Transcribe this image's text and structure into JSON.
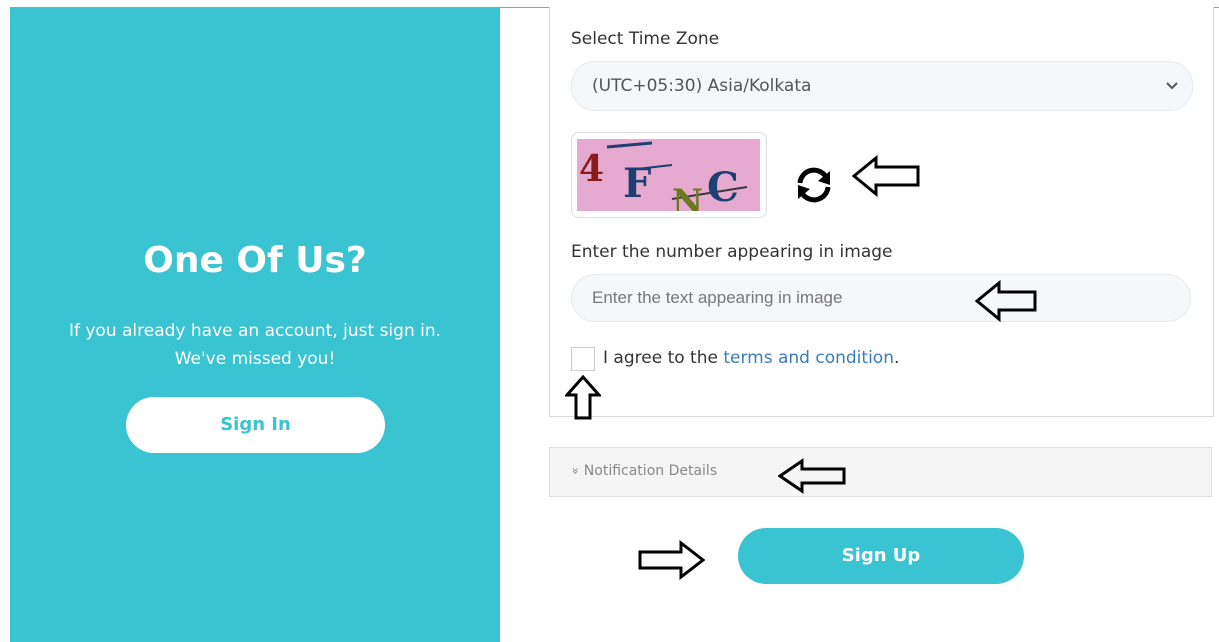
{
  "left": {
    "title": "One Of Us?",
    "line1": "If you already have an account, just sign in.",
    "line2": "We've missed you!",
    "sign_in": "Sign In"
  },
  "form": {
    "timezone_label": "Select Time Zone",
    "timezone_value": "(UTC+05:30) Asia/Kolkata",
    "captcha_text": "4FNC",
    "captcha_label": "Enter the number appearing in image",
    "captcha_placeholder": "Enter the text appearing in image",
    "agree_prefix": "I agree to the ",
    "terms_link": "terms and condition",
    "agree_suffix": "."
  },
  "notification": {
    "icon": "»",
    "label": "Notification Details"
  },
  "sign_up": "Sign Up",
  "colors": {
    "accent": "#3ac3d1",
    "link": "#3b7bbf",
    "captcha_bg": "#e6a9cf"
  }
}
